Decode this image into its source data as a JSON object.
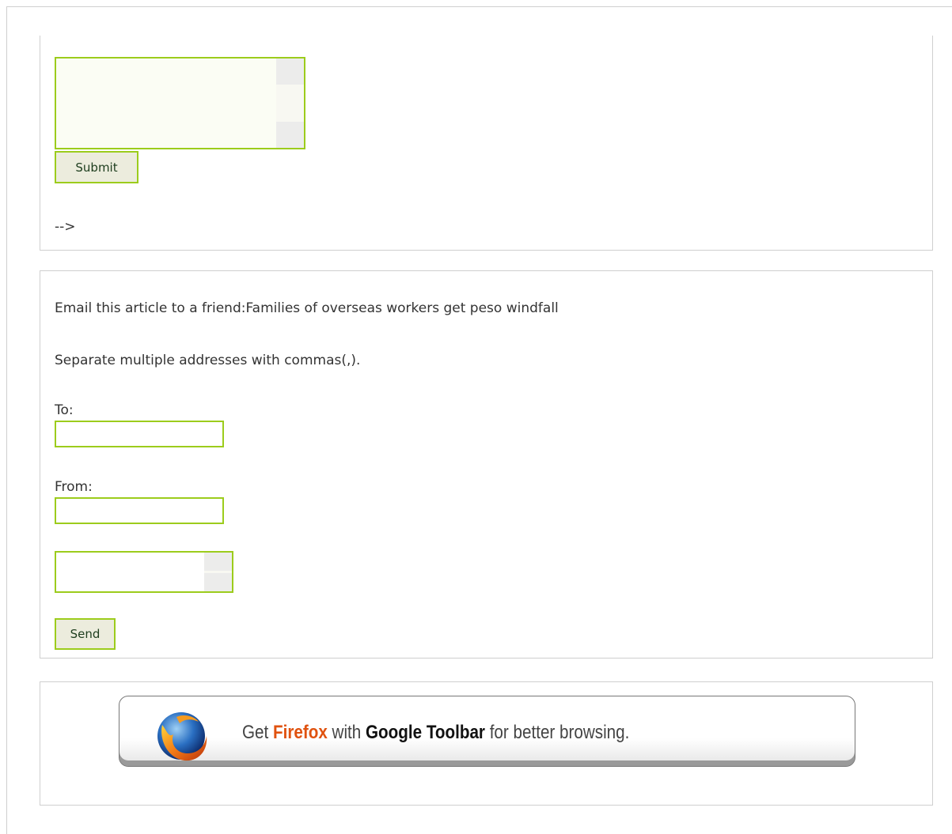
{
  "comment_form": {
    "submit_label": "Submit",
    "comment_close": "-->"
  },
  "email_form": {
    "heading_prefix": "Email this article to a friend:",
    "article_title": "Families of overseas workers get peso windfall",
    "hint": "Separate multiple addresses with commas(,).",
    "to_label": "To:",
    "to_value": "",
    "from_label": "From:",
    "from_value": "",
    "send_label": "Send"
  },
  "firefox_banner": {
    "text_get": "Get ",
    "text_firefox": "Firefox",
    "text_with": " with ",
    "text_google_toolbar": "Google Toolbar",
    "text_rest": " for better browsing.",
    "logo_icon": "firefox-logo-icon"
  },
  "colors": {
    "input_border": "#9ccc1c",
    "button_bg": "#ececdd",
    "firefox_orange": "#e0520f"
  }
}
